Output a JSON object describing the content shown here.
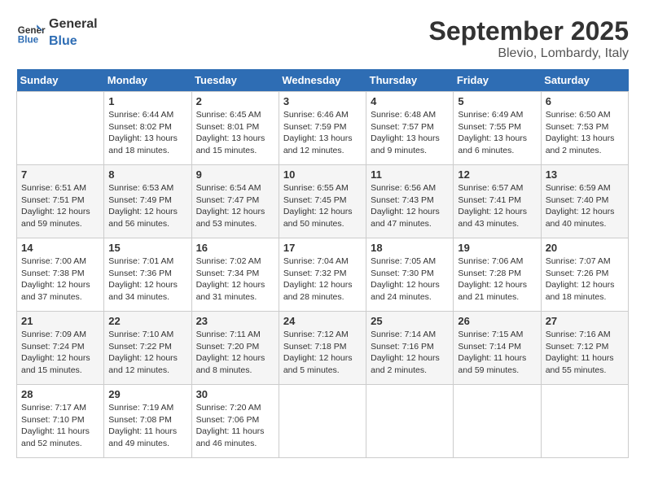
{
  "header": {
    "logo_line1": "General",
    "logo_line2": "Blue",
    "month": "September 2025",
    "location": "Blevio, Lombardy, Italy"
  },
  "weekdays": [
    "Sunday",
    "Monday",
    "Tuesday",
    "Wednesday",
    "Thursday",
    "Friday",
    "Saturday"
  ],
  "weeks": [
    [
      {
        "day": "",
        "info": ""
      },
      {
        "day": "1",
        "info": "Sunrise: 6:44 AM\nSunset: 8:02 PM\nDaylight: 13 hours\nand 18 minutes."
      },
      {
        "day": "2",
        "info": "Sunrise: 6:45 AM\nSunset: 8:01 PM\nDaylight: 13 hours\nand 15 minutes."
      },
      {
        "day": "3",
        "info": "Sunrise: 6:46 AM\nSunset: 7:59 PM\nDaylight: 13 hours\nand 12 minutes."
      },
      {
        "day": "4",
        "info": "Sunrise: 6:48 AM\nSunset: 7:57 PM\nDaylight: 13 hours\nand 9 minutes."
      },
      {
        "day": "5",
        "info": "Sunrise: 6:49 AM\nSunset: 7:55 PM\nDaylight: 13 hours\nand 6 minutes."
      },
      {
        "day": "6",
        "info": "Sunrise: 6:50 AM\nSunset: 7:53 PM\nDaylight: 13 hours\nand 2 minutes."
      }
    ],
    [
      {
        "day": "7",
        "info": "Sunrise: 6:51 AM\nSunset: 7:51 PM\nDaylight: 12 hours\nand 59 minutes."
      },
      {
        "day": "8",
        "info": "Sunrise: 6:53 AM\nSunset: 7:49 PM\nDaylight: 12 hours\nand 56 minutes."
      },
      {
        "day": "9",
        "info": "Sunrise: 6:54 AM\nSunset: 7:47 PM\nDaylight: 12 hours\nand 53 minutes."
      },
      {
        "day": "10",
        "info": "Sunrise: 6:55 AM\nSunset: 7:45 PM\nDaylight: 12 hours\nand 50 minutes."
      },
      {
        "day": "11",
        "info": "Sunrise: 6:56 AM\nSunset: 7:43 PM\nDaylight: 12 hours\nand 47 minutes."
      },
      {
        "day": "12",
        "info": "Sunrise: 6:57 AM\nSunset: 7:41 PM\nDaylight: 12 hours\nand 43 minutes."
      },
      {
        "day": "13",
        "info": "Sunrise: 6:59 AM\nSunset: 7:40 PM\nDaylight: 12 hours\nand 40 minutes."
      }
    ],
    [
      {
        "day": "14",
        "info": "Sunrise: 7:00 AM\nSunset: 7:38 PM\nDaylight: 12 hours\nand 37 minutes."
      },
      {
        "day": "15",
        "info": "Sunrise: 7:01 AM\nSunset: 7:36 PM\nDaylight: 12 hours\nand 34 minutes."
      },
      {
        "day": "16",
        "info": "Sunrise: 7:02 AM\nSunset: 7:34 PM\nDaylight: 12 hours\nand 31 minutes."
      },
      {
        "day": "17",
        "info": "Sunrise: 7:04 AM\nSunset: 7:32 PM\nDaylight: 12 hours\nand 28 minutes."
      },
      {
        "day": "18",
        "info": "Sunrise: 7:05 AM\nSunset: 7:30 PM\nDaylight: 12 hours\nand 24 minutes."
      },
      {
        "day": "19",
        "info": "Sunrise: 7:06 AM\nSunset: 7:28 PM\nDaylight: 12 hours\nand 21 minutes."
      },
      {
        "day": "20",
        "info": "Sunrise: 7:07 AM\nSunset: 7:26 PM\nDaylight: 12 hours\nand 18 minutes."
      }
    ],
    [
      {
        "day": "21",
        "info": "Sunrise: 7:09 AM\nSunset: 7:24 PM\nDaylight: 12 hours\nand 15 minutes."
      },
      {
        "day": "22",
        "info": "Sunrise: 7:10 AM\nSunset: 7:22 PM\nDaylight: 12 hours\nand 12 minutes."
      },
      {
        "day": "23",
        "info": "Sunrise: 7:11 AM\nSunset: 7:20 PM\nDaylight: 12 hours\nand 8 minutes."
      },
      {
        "day": "24",
        "info": "Sunrise: 7:12 AM\nSunset: 7:18 PM\nDaylight: 12 hours\nand 5 minutes."
      },
      {
        "day": "25",
        "info": "Sunrise: 7:14 AM\nSunset: 7:16 PM\nDaylight: 12 hours\nand 2 minutes."
      },
      {
        "day": "26",
        "info": "Sunrise: 7:15 AM\nSunset: 7:14 PM\nDaylight: 11 hours\nand 59 minutes."
      },
      {
        "day": "27",
        "info": "Sunrise: 7:16 AM\nSunset: 7:12 PM\nDaylight: 11 hours\nand 55 minutes."
      }
    ],
    [
      {
        "day": "28",
        "info": "Sunrise: 7:17 AM\nSunset: 7:10 PM\nDaylight: 11 hours\nand 52 minutes."
      },
      {
        "day": "29",
        "info": "Sunrise: 7:19 AM\nSunset: 7:08 PM\nDaylight: 11 hours\nand 49 minutes."
      },
      {
        "day": "30",
        "info": "Sunrise: 7:20 AM\nSunset: 7:06 PM\nDaylight: 11 hours\nand 46 minutes."
      },
      {
        "day": "",
        "info": ""
      },
      {
        "day": "",
        "info": ""
      },
      {
        "day": "",
        "info": ""
      },
      {
        "day": "",
        "info": ""
      }
    ]
  ]
}
